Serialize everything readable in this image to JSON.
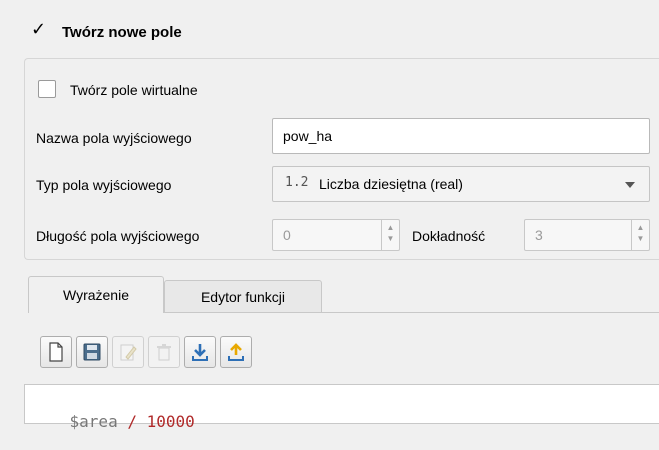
{
  "header": {
    "checkbox_mark": "✓",
    "title": "Twórz nowe pole"
  },
  "virtual_field": {
    "label": "Twórz pole wirtualne"
  },
  "output_name": {
    "label": "Nazwa pola wyjściowego",
    "value": "pow_ha"
  },
  "output_type": {
    "label": "Typ pola wyjściowego",
    "type_icon": "1.2",
    "value": "Liczba dziesiętna (real)"
  },
  "output_length": {
    "label": "Długość pola wyjściowego",
    "value": "0"
  },
  "precision": {
    "label": "Dokładność",
    "value": "3"
  },
  "tabs": [
    {
      "label": "Wyrażenie",
      "active": true
    },
    {
      "label": "Edytor funkcji",
      "active": false
    }
  ],
  "toolbar": {
    "icons": [
      "new-file-icon",
      "save-icon",
      "edit-icon",
      "delete-icon",
      "import-icon",
      "export-icon"
    ]
  },
  "expression": {
    "variable": "$area",
    "operator": " / ",
    "number": "10000"
  },
  "colors": {
    "accent": "#2d6fb6",
    "expression_number": "#b02a2a",
    "expression_variable": "#777777",
    "export_arrow": "#e8a800"
  }
}
